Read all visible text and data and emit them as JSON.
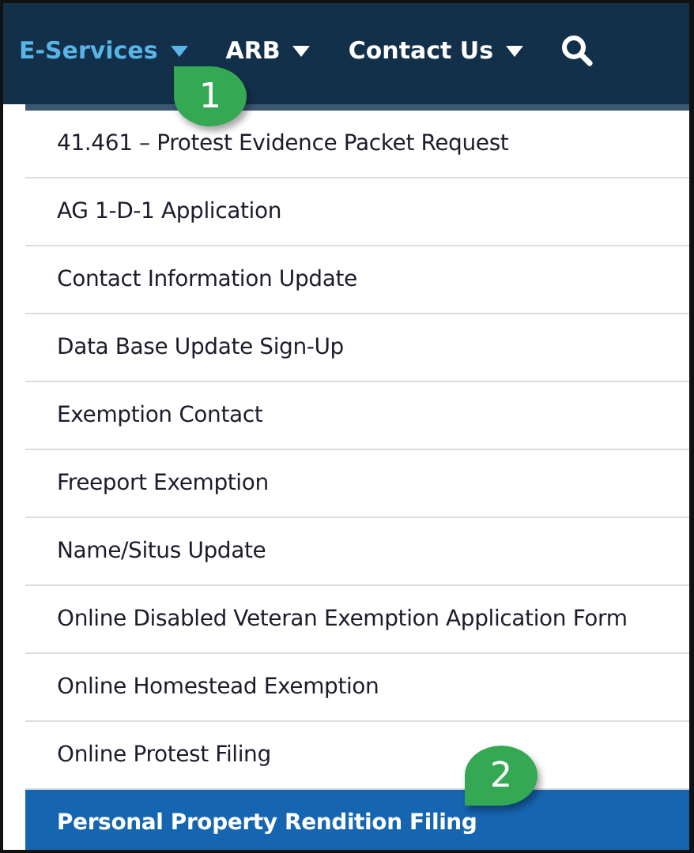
{
  "nav": [
    {
      "label": "E-Services",
      "selected": true
    },
    {
      "label": "ARB",
      "selected": false
    },
    {
      "label": "Contact Us",
      "selected": false
    }
  ],
  "menu": [
    {
      "label": "41.461 – Protest Evidence Packet Request",
      "selected": false
    },
    {
      "label": "AG 1-D-1 Application",
      "selected": false
    },
    {
      "label": "Contact Information Update",
      "selected": false
    },
    {
      "label": "Data Base Update Sign-Up",
      "selected": false
    },
    {
      "label": "Exemption Contact",
      "selected": false
    },
    {
      "label": "Freeport Exemption",
      "selected": false
    },
    {
      "label": "Name/Situs Update",
      "selected": false
    },
    {
      "label": "Online Disabled Veteran Exemption Application Form",
      "selected": false
    },
    {
      "label": "Online Homestead Exemption",
      "selected": false
    },
    {
      "label": "Online Protest Filing",
      "selected": false
    },
    {
      "label": "Personal Property Rendition Filing",
      "selected": true
    }
  ],
  "callouts": [
    {
      "label": "1"
    },
    {
      "label": "2"
    }
  ]
}
